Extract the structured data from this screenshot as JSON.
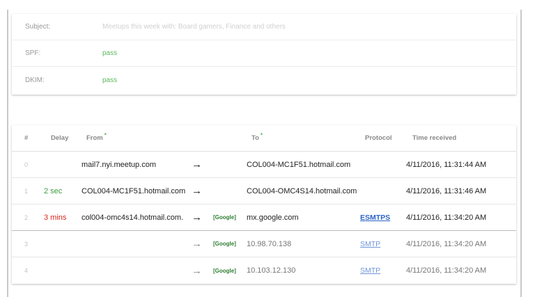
{
  "header_fields": [
    {
      "label": "Subject:",
      "value": "Meetups this week with: Board gamers, Finance and others"
    },
    {
      "label": "SPF:",
      "value": "pass"
    },
    {
      "label": "DKIM:",
      "value": "pass"
    }
  ],
  "hops_table": {
    "columns": {
      "num": "#",
      "delay": "Delay",
      "from": "From",
      "to": "To",
      "protocol": "Protocol",
      "time": "Time received",
      "sort_marker": "*"
    },
    "rows": [
      {
        "num": "0",
        "delay": "",
        "from": "mail7.nyi.meetup.com",
        "arrow": "→",
        "tag": "",
        "to": "COL004-MC1F51.hotmail.com",
        "protocol": "",
        "time": "4/11/2016, 11:31:44 AM"
      },
      {
        "num": "1",
        "delay": "2 sec",
        "from": "COL004-MC1F51.hotmail.com",
        "arrow": "→",
        "tag": "",
        "to": "COL004-OMC4S14.hotmail.com",
        "protocol": "",
        "time": "4/11/2016, 11:31:46 AM"
      },
      {
        "num": "2",
        "delay": "3 mins",
        "from": "col004-omc4s14.hotmail.com.",
        "arrow": "→",
        "tag": "[Google]",
        "to": "mx.google.com",
        "protocol": "ESMTPS",
        "time": "4/11/2016, 11:34:20 AM"
      },
      {
        "num": "3",
        "delay": "",
        "from": "",
        "arrow": "→",
        "tag": "[Google]",
        "to": "10.98.70.138",
        "protocol": "SMTP",
        "time": "4/11/2016, 11:34:20 AM"
      },
      {
        "num": "4",
        "delay": "",
        "from": "",
        "arrow": "→",
        "tag": "[Google]",
        "to": "10.103.12.130",
        "protocol": "SMTP",
        "time": "4/11/2016, 11:34:20 AM"
      }
    ]
  },
  "colors": {
    "pass": "#5cb85c",
    "delay_short": "#3c9e3c",
    "delay_long": "#d9261c",
    "link": "#2a62c9",
    "google_tag": "#2e7d32"
  }
}
